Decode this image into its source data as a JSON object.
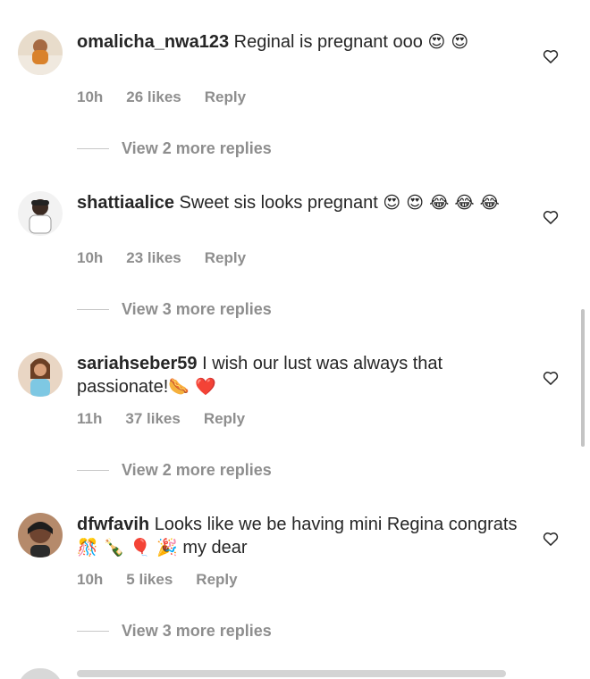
{
  "comments": [
    {
      "username": "omalicha_nwa123",
      "text": "Reginal is pregnant ooo",
      "emojis": "😍 😍",
      "time": "10h",
      "likes": "26 likes",
      "reply": "Reply",
      "view_replies": "View 2 more replies"
    },
    {
      "username": "shattiaalice",
      "text": "Sweet sis looks pregnant",
      "emojis": "😍 😍 😂 😂 😂",
      "time": "10h",
      "likes": "23 likes",
      "reply": "Reply",
      "view_replies": "View 3 more replies"
    },
    {
      "username": "sariahseber59",
      "text": "I wish our lust was always that passionate!",
      "emojis": "🌭 ❤️",
      "time": "11h",
      "likes": "37 likes",
      "reply": "Reply",
      "view_replies": "View 2 more replies"
    },
    {
      "username": "dfwfavih",
      "text": "Looks like we be having mini Regina congrats",
      "emojis": "🎊 🍾 🎈 🎉",
      "text2": "my dear",
      "time": "10h",
      "likes": "5 likes",
      "reply": "Reply",
      "view_replies": "View 3 more replies"
    }
  ],
  "colors": {
    "text": "#262626",
    "muted": "#8e8e8e"
  },
  "icons": {
    "like": "heart-icon"
  }
}
